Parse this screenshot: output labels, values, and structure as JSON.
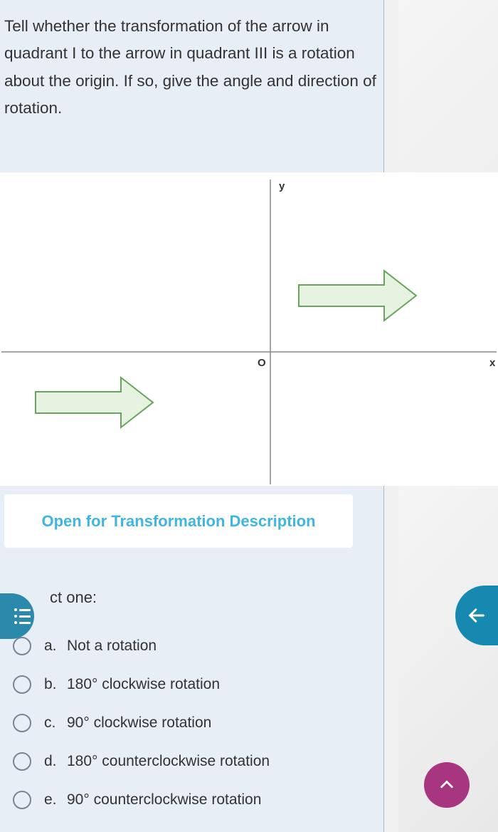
{
  "question": "Tell whether the transformation of the arrow in quadrant I to the arrow in quadrant III is a rotation about the origin. If so, give the angle and direction of rotation.",
  "graph": {
    "y_label": "y",
    "x_label": "x",
    "o_label": "O"
  },
  "open_button": "Open for Transformation Description",
  "select_label": "ct one:",
  "options": [
    {
      "letter": "a.",
      "text": "Not a rotation"
    },
    {
      "letter": "b.",
      "text": "180° clockwise rotation"
    },
    {
      "letter": "c.",
      "text": "90° clockwise rotation"
    },
    {
      "letter": "d.",
      "text": "180° counterclockwise rotation"
    },
    {
      "letter": "e.",
      "text": "90° counterclockwise rotation"
    }
  ]
}
